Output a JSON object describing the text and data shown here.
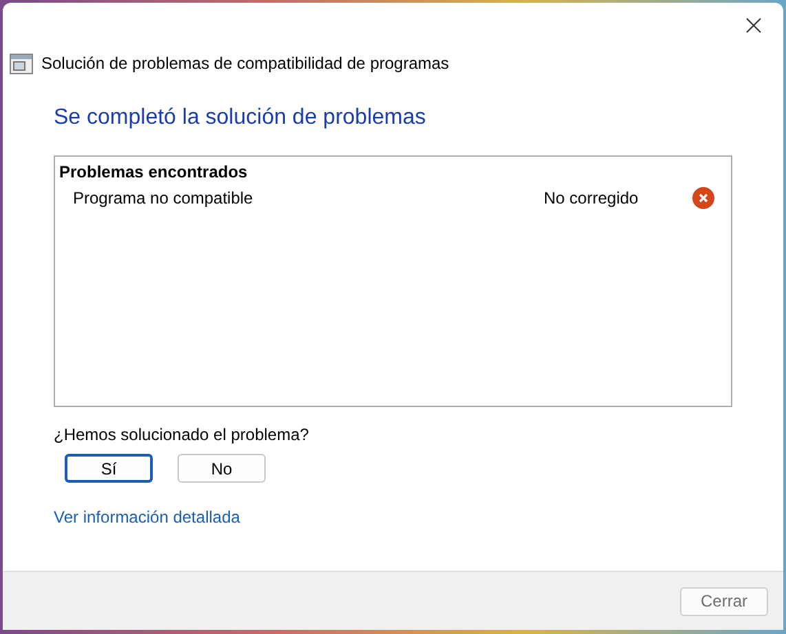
{
  "window": {
    "title": "Solución de problemas de compatibilidad de programas"
  },
  "heading": "Se completó la solución de problemas",
  "problems": {
    "title": "Problemas encontrados",
    "rows": [
      {
        "name": "Programa no compatible",
        "status": "No corregido",
        "kind": "error"
      }
    ]
  },
  "question": "¿Hemos solucionado el problema?",
  "answers": [
    {
      "label": "Sí",
      "focused": true
    },
    {
      "label": "No",
      "focused": false
    }
  ],
  "details_link": "Ver información detallada",
  "footer": {
    "button": "Cerrar",
    "disabled": true
  }
}
